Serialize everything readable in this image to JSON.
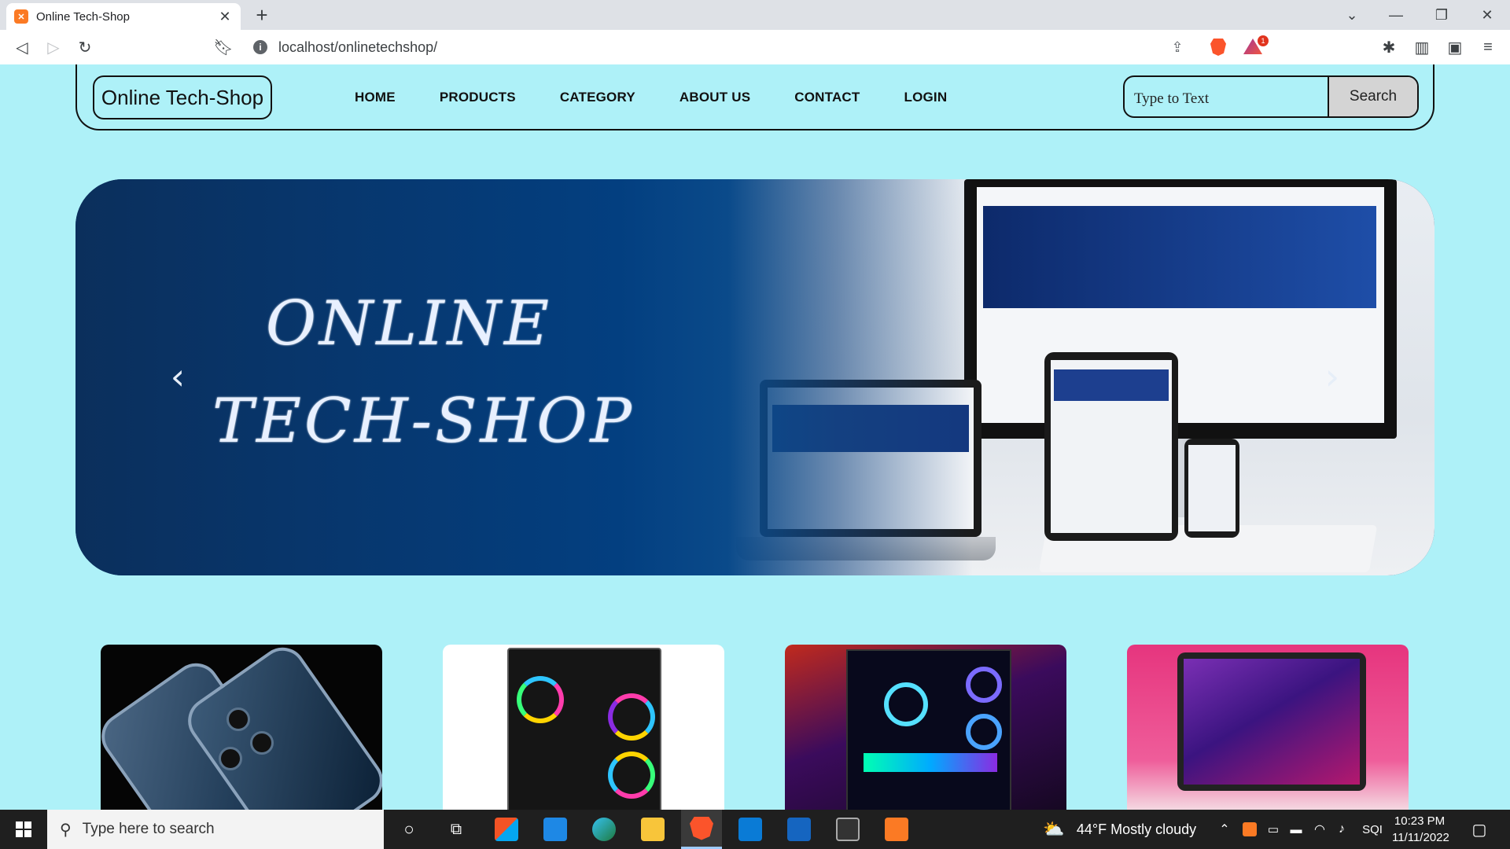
{
  "browser": {
    "tab_title": "Online Tech-Shop",
    "tab_close": "✕",
    "new_tab": "+",
    "url": "localhost/onlinetechshop/",
    "rewards_badge": "1"
  },
  "site": {
    "logo_text": "Online Tech-Shop",
    "nav": [
      {
        "label": "HOME"
      },
      {
        "label": "PRODUCTS"
      },
      {
        "label": "CATEGORY"
      },
      {
        "label": "ABOUT US"
      },
      {
        "label": "CONTACT"
      },
      {
        "label": "LOGIN"
      }
    ],
    "search": {
      "placeholder": "Type to Text",
      "button_label": "Search"
    },
    "hero": {
      "line1": "ONLINE",
      "line2": "TECH-SHOP",
      "prev_arrow": "‹",
      "next_arrow": "›"
    },
    "cards": [
      {
        "subject": "smartphone"
      },
      {
        "subject": "gaming-pc"
      },
      {
        "subject": "rgb-gaming-pc"
      },
      {
        "subject": "laptop"
      }
    ],
    "colors": {
      "page_background": "#aef1f8",
      "hero_blue": "#033f80"
    }
  },
  "taskbar": {
    "search_placeholder": "Type here to search",
    "weather": "44°F  Mostly cloudy",
    "language": "SQI",
    "time": "10:23 PM",
    "date": "11/11/2022"
  }
}
